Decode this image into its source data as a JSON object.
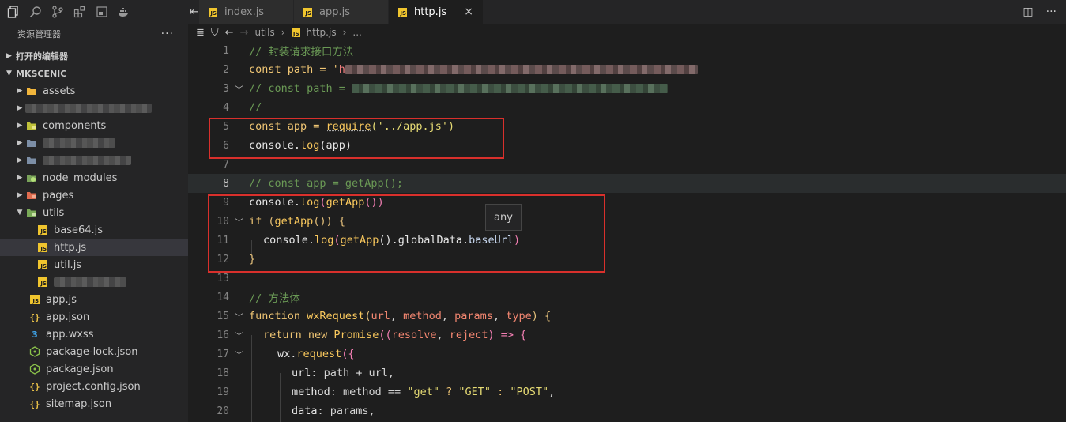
{
  "activity_icons": [
    "copy-icon",
    "search-icon",
    "source-control-icon",
    "extensions-icon",
    "remote-icon",
    "docker-icon"
  ],
  "explorer": {
    "title": "资源管理器",
    "more": "···",
    "open_editors": "打开的编辑器",
    "project": "MKSCENIC",
    "items": [
      {
        "label": "assets",
        "type": "folder"
      },
      {
        "label": "",
        "type": "blurred"
      },
      {
        "label": "components",
        "type": "folder"
      },
      {
        "label": "",
        "type": "blurred"
      },
      {
        "label": "",
        "type": "blurred"
      },
      {
        "label": "node_modules",
        "type": "folder"
      },
      {
        "label": "pages",
        "type": "folder"
      },
      {
        "label": "utils",
        "type": "folder-open"
      },
      {
        "label": "base64.js",
        "type": "js"
      },
      {
        "label": "http.js",
        "type": "js"
      },
      {
        "label": "util.js",
        "type": "js"
      },
      {
        "label": "",
        "type": "blurred"
      },
      {
        "label": "app.js",
        "type": "js"
      },
      {
        "label": "app.json",
        "type": "json"
      },
      {
        "label": "app.wxss",
        "type": "css"
      },
      {
        "label": "package-lock.json",
        "type": "npm"
      },
      {
        "label": "package.json",
        "type": "npm"
      },
      {
        "label": "project.config.json",
        "type": "json"
      },
      {
        "label": "sitemap.json",
        "type": "json"
      }
    ]
  },
  "tabs": [
    {
      "label": "index.js",
      "active": false
    },
    {
      "label": "app.js",
      "active": false
    },
    {
      "label": "http.js",
      "active": true
    }
  ],
  "tab_close": "×",
  "breadcrumb": {
    "folder": "utils",
    "file": "http.js",
    "more": "..."
  },
  "tooltip": "any",
  "code": {
    "l1": "// 封装请求接口方法",
    "l2a": "const path = '",
    "l2b": "h",
    "l3": "// const path = ",
    "l4": "//",
    "l5a": "const app = ",
    "l5b": "require",
    "l5c": "('../app.js')",
    "l6a": "console.",
    "l6b": "log",
    "l6c": "(app)",
    "l8": "// const app = getApp();",
    "l9a": "console.",
    "l9b": "log",
    "l9c": "(",
    "l9d": "getApp",
    "l9e": "())",
    "l10a": "if",
    "l10b": " (",
    "l10c": "getApp",
    "l10d": "()) {",
    "l11a": "console.",
    "l11b": "log",
    "l11c": "(",
    "l11d": "getApp",
    "l11e": "().globalData.",
    "l11f": "baseUrl",
    "l11g": ")",
    "l12": "}",
    "l14": "// 方法体",
    "l15a": "function ",
    "l15b": "wxRequest",
    "l15c": "(",
    "l15d": "url",
    "l15e": ", ",
    "l15f": "method",
    "l15g": ", ",
    "l15h": "params",
    "l15i": ", ",
    "l15j": "type",
    "l15k": ") {",
    "l16a": "return ",
    "l16b": "new ",
    "l16c": "Promise",
    "l16d": "((",
    "l16e": "resolve",
    "l16f": ", ",
    "l16g": "reject",
    "l16h": ") => {",
    "l17a": "wx.",
    "l17b": "request",
    "l17c": "({",
    "l18a": "url",
    "l18b": ": path + url,",
    "l19a": "method",
    "l19b": ": method == ",
    "l19c": "\"get\"",
    "l19d": " ? ",
    "l19e": "\"GET\"",
    "l19f": " : ",
    "l19g": "\"POST\"",
    "l19h": ",",
    "l20a": "data",
    "l20b": ": params,"
  },
  "line_numbers": [
    "1",
    "2",
    "3",
    "4",
    "5",
    "6",
    "7",
    "8",
    "9",
    "10",
    "11",
    "12",
    "13",
    "14",
    "15",
    "16",
    "17",
    "18",
    "19",
    "20"
  ],
  "accent": "#d9302c"
}
